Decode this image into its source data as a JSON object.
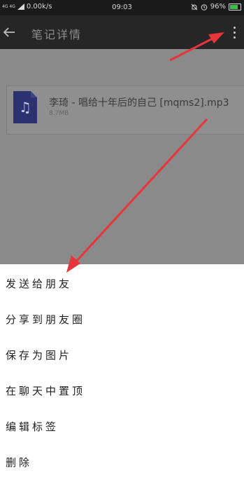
{
  "status_bar": {
    "network": "4G 4G",
    "speed": "0.00k/s",
    "time": "09:03",
    "battery": "96%"
  },
  "app_bar": {
    "title": "笔记详情"
  },
  "file": {
    "name": "李琦 - 唱给十年后的自己 [mqms2].mp3",
    "size": "8.7MB"
  },
  "menu": {
    "items": [
      {
        "label": "发送给朋友"
      },
      {
        "label": "分享到朋友圈"
      },
      {
        "label": "保存为图片"
      },
      {
        "label": "在聊天中置顶"
      },
      {
        "label": "编辑标签"
      },
      {
        "label": "删除"
      }
    ]
  },
  "colors": {
    "arrow": "#e8353a",
    "overlay": "#8a8a8a",
    "file_icon": "#2c3270"
  }
}
